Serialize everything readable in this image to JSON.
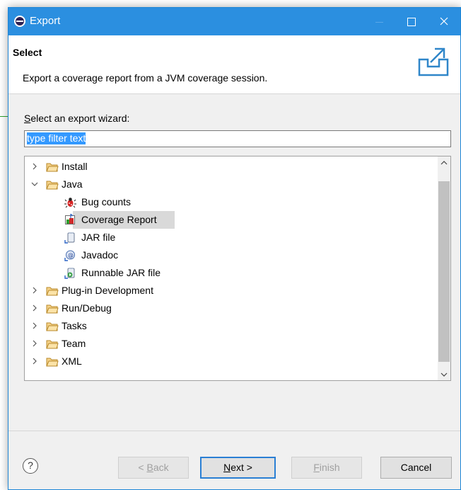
{
  "window": {
    "title": "Export"
  },
  "header": {
    "title": "Select",
    "description": "Export a coverage report from a JVM coverage session."
  },
  "wizard": {
    "label_prefix": "S",
    "label_rest": "elect an export wizard:",
    "filter_value": "type filter text"
  },
  "tree": {
    "items": [
      {
        "label": "Install",
        "expanded": false
      },
      {
        "label": "Java",
        "expanded": true
      },
      {
        "label": "Bug counts"
      },
      {
        "label": "Coverage Report",
        "selected": true
      },
      {
        "label": "JAR file"
      },
      {
        "label": "Javadoc"
      },
      {
        "label": "Runnable JAR file"
      },
      {
        "label": "Plug-in Development",
        "expanded": false
      },
      {
        "label": "Run/Debug",
        "expanded": false
      },
      {
        "label": "Tasks",
        "expanded": false
      },
      {
        "label": "Team",
        "expanded": false
      },
      {
        "label": "XML",
        "expanded": false
      }
    ]
  },
  "buttons": {
    "help": "?",
    "back_mn": "B",
    "back_rest": "ack",
    "back_prefix": "< ",
    "next_mn": "N",
    "next_rest": "ext >",
    "finish_mn": "F",
    "finish_rest": "inish",
    "cancel": "Cancel"
  },
  "colors": {
    "titlebar": "#2b8fe0",
    "selection": "#3399ff"
  }
}
